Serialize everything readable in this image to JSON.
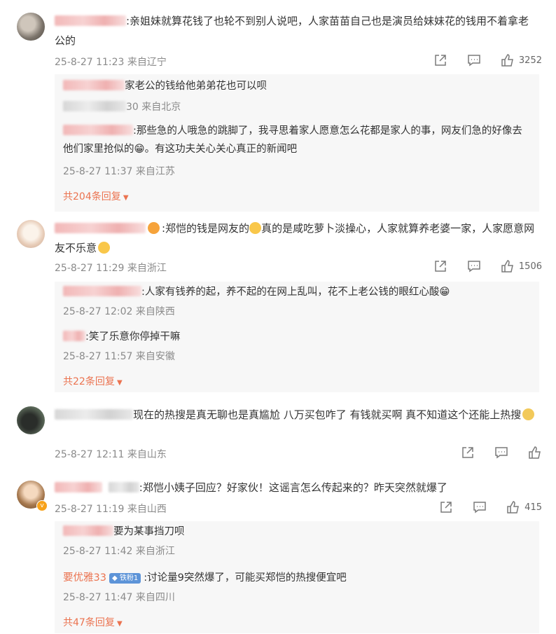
{
  "icons": {
    "share": "share-icon",
    "comment": "comment-icon",
    "like": "like-icon",
    "more": "caret-down-icon"
  },
  "comments": [
    {
      "text": ":亲姐妹就算花钱了也轮不到别人说吧，人家苗苗自己也是演员给妹妹花的钱用不着拿老公的",
      "meta": "25-8-27 11:23 来自辽宁",
      "likes": "3252",
      "replies": [
        {
          "text": "家老公的钱给他弟弟花也可以呗",
          "meta": "30 来自北京"
        },
        {
          "text": ":那些急的人哦急的跳脚了，我寻思着家人愿意怎么花都是家人的事，网友们急的好像去他们家里抢似的😁。有这功夫关心关心真正的新闻吧",
          "meta": "25-8-27 11:37 来自江苏"
        }
      ],
      "more": "共204条回复"
    },
    {
      "text_a": ":郑恺的钱是网友的",
      "text_b": "真的是咸吃萝卜淡操心，人家就算养老婆一家，人家愿意网友不乐意",
      "meta": "25-8-27 11:29 来自浙江",
      "likes": "1506",
      "replies": [
        {
          "text": ":人家有钱养的起，养不起的在网上乱叫，花不上老公钱的眼红心酸😁",
          "meta": "25-8-27 12:02 来自陕西"
        },
        {
          "text": ":笑了乐意你停掉干嘛",
          "meta": "25-8-27 11:57 来自安徽"
        }
      ],
      "more": "共22条回复"
    },
    {
      "text": "现在的热搜是真无聊也是真尴尬 八万买包咋了 有钱就买啊 真不知道这个还能上热搜",
      "meta": "25-8-27 12:11 来自山东",
      "likes": ""
    },
    {
      "text": ":郑恺小姨子回应？好家伙！这谣言怎么传起来的？昨天突然就爆了",
      "meta": "25-8-27 11:19 来自山西",
      "likes": "415",
      "replies": [
        {
          "text": "要为某事挡刀呗",
          "meta": "25-8-27 11:42 来自浙江"
        },
        {
          "user": "要优雅33",
          "tag": "铁粉1",
          "text": ":讨论量9突然爆了，可能买郑恺的热搜便宜吧",
          "meta": "25-8-27 11:47 来自四川"
        }
      ],
      "more": "共47条回复"
    }
  ]
}
